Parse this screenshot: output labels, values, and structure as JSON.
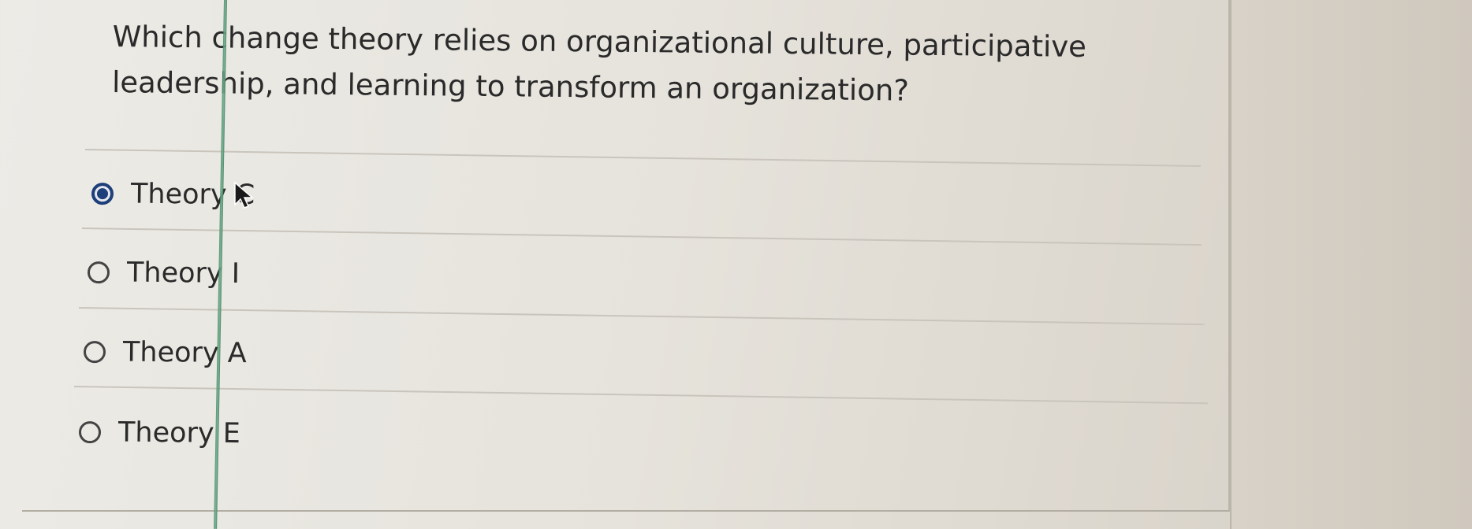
{
  "question": {
    "text": "Which change theory relies on organizational culture, participative leadership, and learning to transform an organization?"
  },
  "options": [
    {
      "label": "Theory C",
      "selected": true
    },
    {
      "label": "Theory I",
      "selected": false
    },
    {
      "label": "Theory A",
      "selected": false
    },
    {
      "label": "Theory E",
      "selected": false
    }
  ],
  "icons": {
    "cursor": "mouse-pointer-icon"
  },
  "colors": {
    "selected_radio": "#1d3f7a",
    "text": "#2a2a2a",
    "divider": "#c9c5bd"
  }
}
